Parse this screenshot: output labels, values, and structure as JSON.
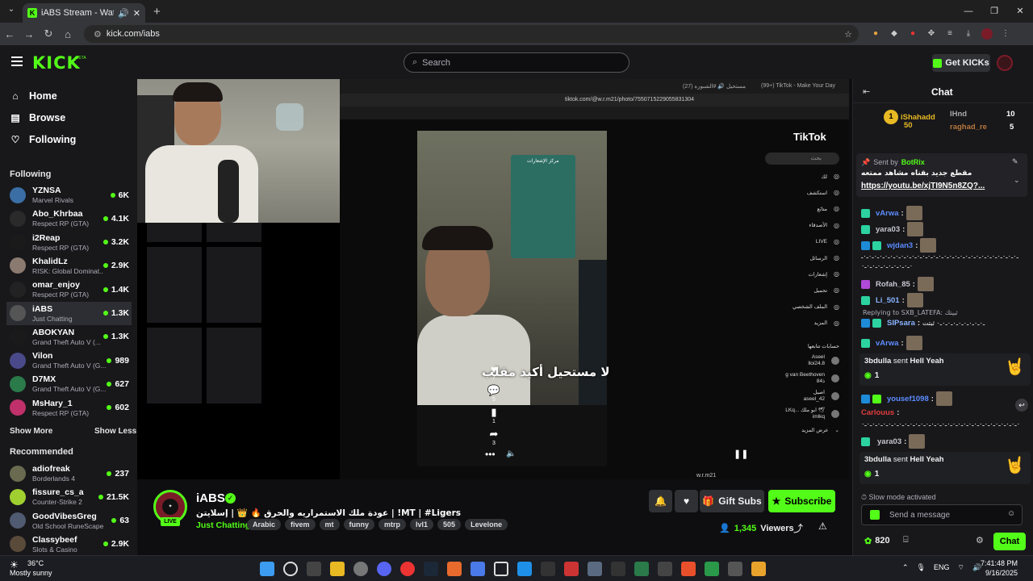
{
  "browser": {
    "tab_title": "iABS Stream - Watch Live o",
    "url": "kick.com/iabs"
  },
  "header": {
    "logo": "KICK",
    "beta": "BETA",
    "search_placeholder": "Search",
    "get_kicks": "Get KICKs"
  },
  "sidebar": {
    "nav": [
      {
        "label": "Home",
        "icon": "home-icon"
      },
      {
        "label": "Browse",
        "icon": "browse-icon"
      },
      {
        "label": "Following",
        "icon": "heart-icon"
      }
    ],
    "following_title": "Following",
    "following": [
      {
        "name": "YZNSA",
        "category": "Marvel Rivals",
        "viewers": "6K",
        "color": "#3a6ea5"
      },
      {
        "name": "Abo_Khrbaa",
        "category": "Respect RP (GTA)",
        "viewers": "4.1K",
        "color": "#2a2a2a"
      },
      {
        "name": "i2Reap",
        "category": "Respect RP (GTA)",
        "viewers": "3.2K",
        "color": "#1a1a1a"
      },
      {
        "name": "KhalidLz",
        "category": "RISK: Global Dominat...",
        "viewers": "2.9K",
        "color": "#8a7a70"
      },
      {
        "name": "omar_enjoy",
        "category": "Respect RP (GTA)",
        "viewers": "1.4K",
        "color": "#222222"
      },
      {
        "name": "iABS",
        "category": "Just Chatting",
        "viewers": "1.3K",
        "color": "#555555"
      },
      {
        "name": "ABOKYAN",
        "category": "Grand Theft Auto V (...",
        "viewers": "1.3K",
        "color": "#1a1a1a"
      },
      {
        "name": "Vilon",
        "category": "Grand Theft Auto V (G...",
        "viewers": "989",
        "color": "#4a4a8a"
      },
      {
        "name": "D7MX",
        "category": "Grand Theft Auto V (G...",
        "viewers": "627",
        "color": "#2a7a4a"
      },
      {
        "name": "MsHary_1",
        "category": "Respect RP (GTA)",
        "viewers": "602",
        "color": "#c0306a"
      }
    ],
    "show_more": "Show More",
    "show_less": "Show Less",
    "recommended_title": "Recommended",
    "recommended": [
      {
        "name": "adiofreak",
        "category": "Borderlands 4",
        "viewers": "237",
        "color": "#6a6a50"
      },
      {
        "name": "fissure_cs_a",
        "category": "Counter-Strike 2",
        "viewers": "21.5K",
        "color": "#a0d030"
      },
      {
        "name": "GoodVibesGreg",
        "category": "Old School RuneScape",
        "viewers": "63",
        "color": "#505a70"
      },
      {
        "name": "Classybeef",
        "category": "Slots & Casino",
        "viewers": "2.9K",
        "color": "#5a4a3a"
      }
    ]
  },
  "video": {
    "tiktok_brand": "TikTok",
    "caption": "لا مستحيل أكيد مقلب",
    "likes": "7",
    "comments": "5",
    "saves": "1",
    "shares": "3",
    "tt_url": "tiktok.com/@w.r.m21/photo/7550715229055831304",
    "tt_tab1": "مستحيل 🔊 #الشبوره (27)",
    "tt_tab2": "(99+) TikTok - Make Your Day",
    "tt_user": "w.r.m21",
    "tt_search": "بحث",
    "tt_nav": [
      "لك",
      "استكشف",
      "متابَع",
      "الأصدقاء",
      "LIVE",
      "الرسائل",
      "إشعارات",
      "تحميل",
      "الملف الشخصي",
      "المزيد"
    ],
    "tt_following_title": "حسابات تتابعها",
    "tt_following": [
      "Aseel\nlloi24.8",
      "g van Beethoven\n8ذ4",
      "اصيل\naseel_42",
      "LKq... ابو ملك 🕊\nimlkq"
    ],
    "tt_see_more": "عرض المزيد",
    "tt_notifications": "مركز الإشعارات"
  },
  "stream_info": {
    "channel": "iABS",
    "live": "LIVE",
    "title": "عودة ملك الاستمراريه والحرق 🔥 👑 | إسلايتن | !MT | #Ligers",
    "category": "Just Chatting",
    "tags": [
      "Arabic",
      "fivem",
      "mt",
      "funny",
      "mtrp",
      "lvl1",
      "505",
      "Levelone"
    ],
    "gift_subs": "Gift Subs",
    "subscribe": "Subscribe",
    "viewers": "1,345",
    "viewers_label": "Viewers"
  },
  "chat": {
    "title": "Chat",
    "leaderboard": [
      {
        "rank": "1",
        "name": "iShahadd",
        "value": "50"
      },
      {
        "rank": "",
        "name": "IHnd",
        "value": "10"
      },
      {
        "rank": "",
        "name": "raghad_re",
        "value": "5"
      }
    ],
    "pinned": {
      "sent_by": "Sent by",
      "bot": "BotRix",
      "text": "مقطع جديد بقناه مشاهد ممتعه",
      "link": "https://youtu.be/xjTI9N5n8ZQ?..."
    },
    "messages": [
      {
        "user": "vArwa",
        "color": "#5b8cff",
        "text": ""
      },
      {
        "user": "yara03",
        "color": "#c7c7d1",
        "text": ""
      },
      {
        "user": "wjdan3",
        "color": "#5b8cff",
        "text": ""
      },
      {
        "user": "",
        "color": "#ffffff",
        "text": "ـ٠ـ٠ـ٠ـ٠ـ٠ـ٠ـ٠ـ٠ـ٠ـ٠ـ٠ـ٠ـ٠ـ٠ـ٠ـ٠ـ٠ـ٠ـ٠ـ٠ـ٠ـ٠ـ٠ـ٠ـ٠ـ٠ـ٠ـ٠ـ٠ـ٠ـ٠ـ٠ـ٠ـ٠ـ٠ـ٠ـ٠ـ٠ـ٠"
      },
      {
        "user": "Rofah_85",
        "color": "#c7c7d1",
        "text": ""
      },
      {
        "user": "Li_501",
        "color": "#8ab4ff",
        "text": ""
      },
      {
        "user": "SIPsara",
        "color": "#8ab4ff",
        "text": "ـ٠ـ٠ـ٠ـ٠ـ٠ـ٠ـ٠ـ٠ـ٠ ثبتت"
      },
      {
        "user": "vArwa",
        "color": "#5b8cff",
        "text": ""
      }
    ],
    "reply_to": "Replying to SXB_LATEFA: ثبيتك",
    "gift1": {
      "user": "3bdulla",
      "action": "sent",
      "item": "Hell Yeah",
      "count": "1"
    },
    "msg_yousef": {
      "user": "yousef1098",
      "color": "#5b8cff"
    },
    "msg_carlouus": {
      "user": "Carlouus",
      "color": "#e23d3d",
      "text": "ـ٠ـ٠ـ٠ـ٠ـ٠ـ٠ـ٠ـ٠ـ٠ـ٠ـ٠ـ٠ـ٠ـ٠ـ٠ـ٠ـ٠ـ٠ـ٠ـ٠ـ٠ـ٠ـ٠ـ٠ـ٠ـ٠ـ٠ـ٠ـ٠ـ٠ـ٠ـ٠ـ٠"
    },
    "msg_yara": {
      "user": "yara03",
      "color": "#c7c7d1"
    },
    "gift2": {
      "user": "3bdulla",
      "action": "sent",
      "item": "Hell Yeah",
      "count": "1"
    },
    "slow_mode": "Slow mode activated",
    "input_placeholder": "Send a message",
    "points": "820",
    "chat_button": "Chat"
  },
  "taskbar": {
    "temp": "36°C",
    "weather": "Mostly sunny",
    "lang": "ENG",
    "time": "7:41:48 PM",
    "date": "9/16/2025"
  },
  "colors": {
    "accent": "#53fc18",
    "bg": "#0e0e10",
    "panel": "#18181b"
  }
}
